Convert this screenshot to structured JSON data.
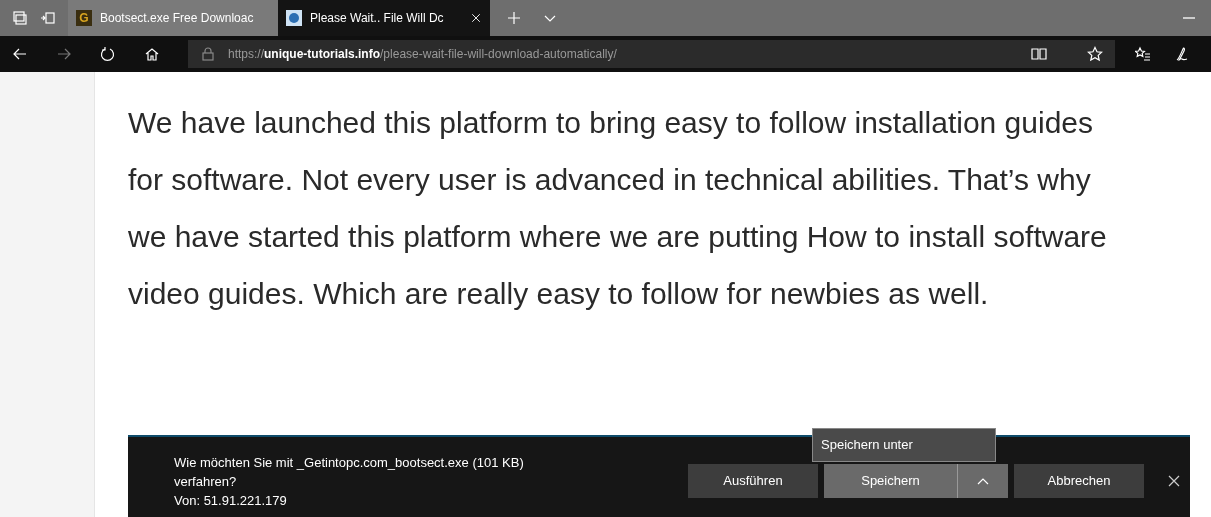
{
  "tabs": [
    {
      "label": "Bootsect.exe Free Downloac",
      "selected": false,
      "favicon": "G"
    },
    {
      "label": "Please Wait.. File Will Dc",
      "selected": true
    }
  ],
  "address_bar": {
    "scheme": "https://",
    "domain": "unique-tutorials.info",
    "path": "/please-wait-file-will-download-automatically/"
  },
  "article": {
    "paragraph": "We have launched this platform to bring easy to follow installation guides for software. Not every user is advanced in technical abilities. That’s why we have started this platform where we are putting How to install software video guides. Which are really easy to follow for newbies as well."
  },
  "download_bar": {
    "message_lines": [
      "Wie möchten Sie mit _Getintopc.com_bootsect.exe (101 KB)",
      "verfahren?",
      "Von: 51.91.221.179"
    ],
    "buttons": [
      "Ausführen",
      "Speichern",
      "Abbrechen"
    ],
    "menu": {
      "expanded": true,
      "items": [
        "Speichern unter"
      ]
    }
  }
}
